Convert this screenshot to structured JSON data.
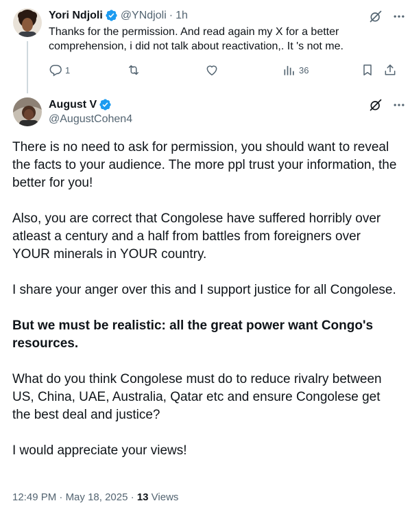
{
  "reply": {
    "name": "Yori Ndjoli",
    "handle": "@YNdjoli",
    "separator": "·",
    "time": "1h",
    "text": "Thanks for the permission. And read again my X for a better comprehension, i did not talk about reactivation,. It 's not me.",
    "reply_count": "1",
    "views_count": "36",
    "icons": [
      "grok-icon",
      "more-icon",
      "reply-icon",
      "repost-icon",
      "like-icon",
      "views-icon",
      "bookmark-icon",
      "share-icon"
    ]
  },
  "main": {
    "name": "August V",
    "handle": "@AugustCohen4",
    "paragraphs": [
      "There is no need to ask for permission, you should want to reveal the facts to your audience. The more ppl trust your information, the better for you!",
      "Also, you are correct that Congolese have suffered horribly over atleast a century and a half from battles from foreigners over YOUR minerals in YOUR country.",
      "I share your anger over this and I support justice for all Congolese.",
      "But we must be realistic: all the great power want Congo's resources.",
      "What do you think Congolese must do to reduce rivalry between US, China, UAE, Australia, Qatar etc and ensure Congolese get the best deal and justice?",
      "I would appreciate your views!"
    ],
    "meta": {
      "time": "12:49 PM",
      "sep1": "·",
      "date": "May 18, 2025",
      "sep2": "·",
      "views_count": "13",
      "views_label": "Views"
    }
  },
  "colors": {
    "verified": "#1d9bf0",
    "text": "#0f1419",
    "secondary": "#536471",
    "thread_line": "#cfd9de"
  }
}
